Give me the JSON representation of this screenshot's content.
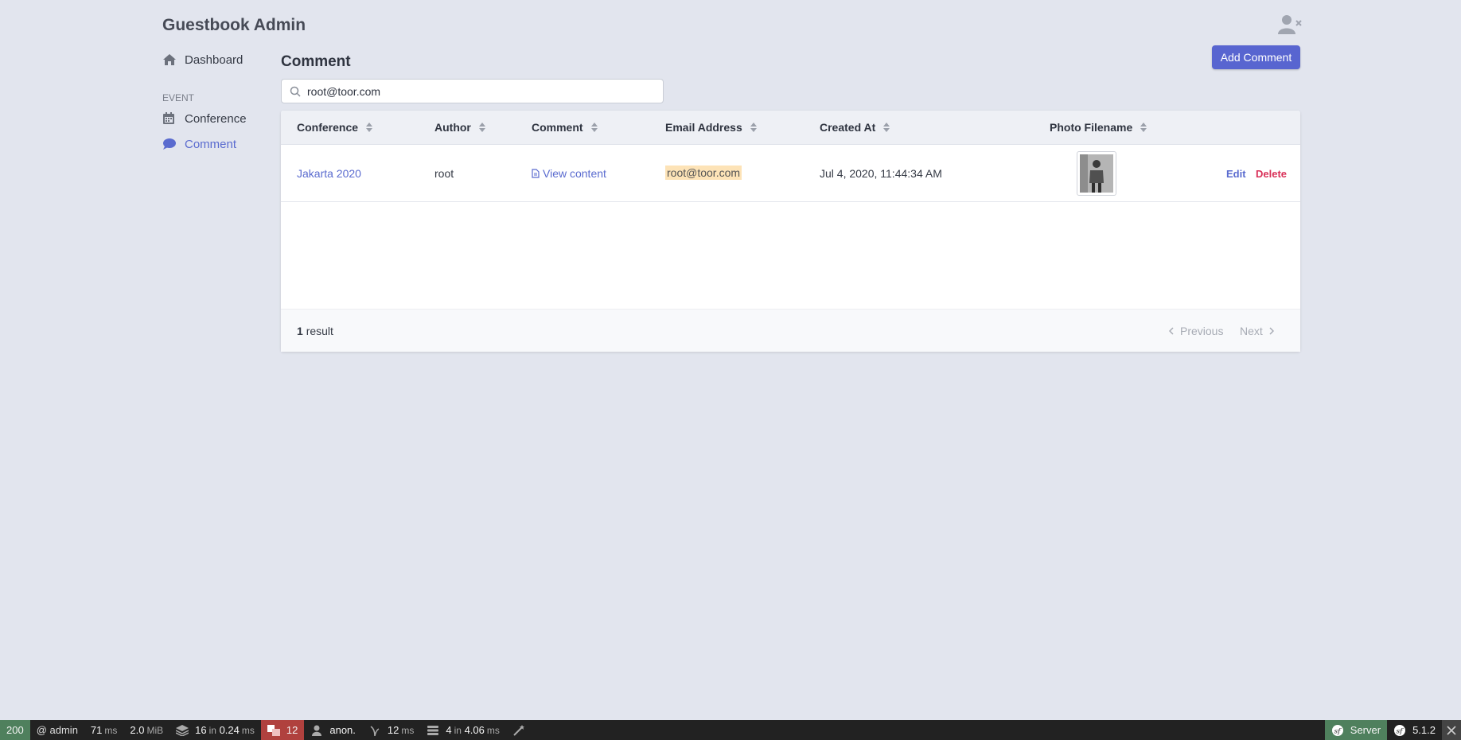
{
  "app": {
    "title": "Guestbook Admin"
  },
  "sidebar": {
    "dashboard": "Dashboard",
    "section": "EVENT",
    "items": [
      {
        "label": "Conference"
      },
      {
        "label": "Comment"
      }
    ]
  },
  "main": {
    "title": "Comment",
    "add_button": "Add Comment",
    "search": {
      "value": "root@toor.com"
    },
    "columns": [
      "Conference",
      "Author",
      "Comment",
      "Email Address",
      "Created At",
      "Photo Filename"
    ],
    "rows": [
      {
        "conference": "Jakarta 2020",
        "author": "root",
        "comment": "View content",
        "email": "root@toor.com",
        "created_at": "Jul 4, 2020, 11:44:34 AM",
        "edit": "Edit",
        "delete": "Delete"
      }
    ],
    "footer": {
      "count": "1",
      "result_label": "result",
      "previous": "Previous",
      "next": "Next"
    }
  },
  "debug_bar": {
    "status": "200",
    "route": "@ admin",
    "time": "71",
    "time_unit": "ms",
    "memory": "2.0",
    "memory_unit": "MiB",
    "forms": "16",
    "forms_in": "in",
    "forms_time": "0.24",
    "forms_unit": "ms",
    "translations": "12",
    "user": "anon.",
    "twig": "12",
    "twig_unit": "ms",
    "db": "4",
    "db_in": "in",
    "db_time": "4.06",
    "db_unit": "ms",
    "server": "Server",
    "version": "5.1.2"
  },
  "colors": {
    "accent": "#5865d0",
    "danger": "#d93058",
    "highlight": "#fde3b7"
  }
}
